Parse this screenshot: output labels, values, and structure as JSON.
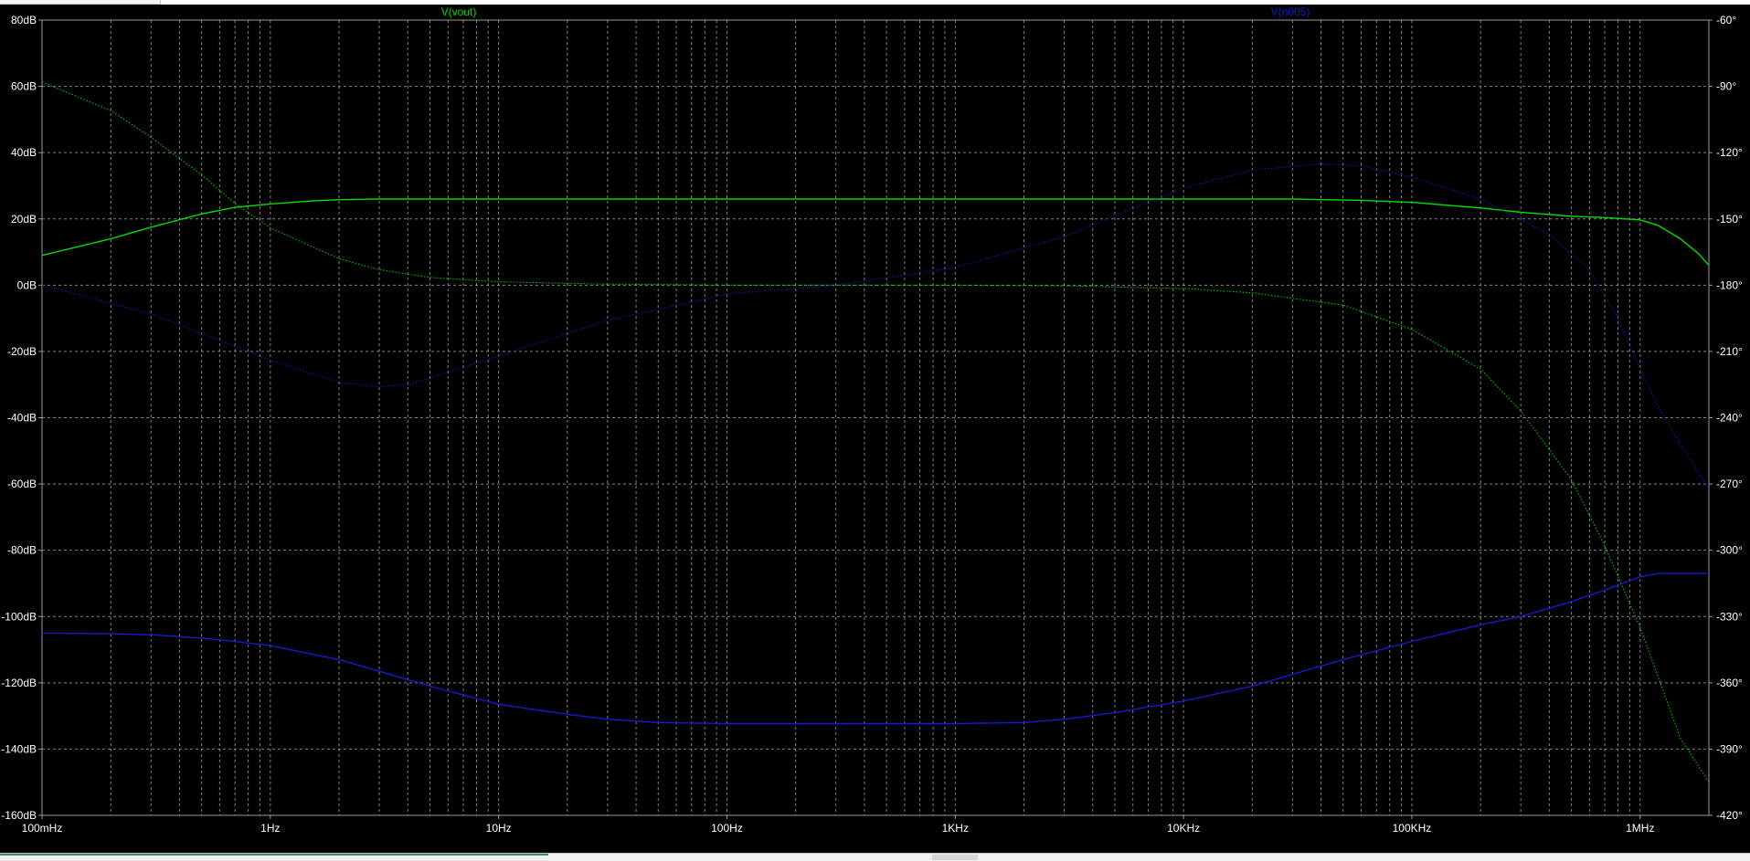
{
  "window": {
    "top_bar": "",
    "bottom_bar": ""
  },
  "colors": {
    "background": "#000000",
    "grid": "#9a9a9a",
    "axis_frame": "#9a9a9a",
    "tick_text": "#ffffff",
    "vout": "#00dd00",
    "vn005": "#1a1acc"
  },
  "chart_data": {
    "type": "line",
    "title": "",
    "x_scale": "log",
    "xlim": [
      0.1,
      2000000
    ],
    "x_ticks": [
      {
        "value": 0.1,
        "label": "100mHz"
      },
      {
        "value": 1,
        "label": "1Hz"
      },
      {
        "value": 10,
        "label": "10Hz"
      },
      {
        "value": 100,
        "label": "100Hz"
      },
      {
        "value": 1000,
        "label": "1KHz"
      },
      {
        "value": 10000,
        "label": "10KHz"
      },
      {
        "value": 100000,
        "label": "100KHz"
      },
      {
        "value": 1000000,
        "label": "1MHz"
      }
    ],
    "y_left": {
      "unit": "dB",
      "ylim": [
        -160,
        80
      ],
      "ticks": [
        "80dB",
        "60dB",
        "40dB",
        "20dB",
        "0dB",
        "-20dB",
        "-40dB",
        "-60dB",
        "-80dB",
        "-100dB",
        "-120dB",
        "-140dB",
        "-160dB"
      ]
    },
    "y_right": {
      "unit": "°",
      "ylim": [
        -420,
        -60
      ],
      "ticks": [
        "-60°",
        "-90°",
        "-120°",
        "-150°",
        "-180°",
        "-210°",
        "-240°",
        "-270°",
        "-300°",
        "-330°",
        "-360°",
        "-390°",
        "-420°"
      ]
    },
    "grid": true,
    "legend_position": "top",
    "series": [
      {
        "name": "V(vout)",
        "color": "#00dd00",
        "magnitude_db": [
          [
            0.1,
            9
          ],
          [
            0.2,
            14
          ],
          [
            0.3,
            17.5
          ],
          [
            0.5,
            21.5
          ],
          [
            0.7,
            23.5
          ],
          [
            1,
            24.5
          ],
          [
            1.5,
            25.4
          ],
          [
            2,
            25.8
          ],
          [
            3,
            26
          ],
          [
            10,
            26
          ],
          [
            1000,
            26
          ],
          [
            10000,
            26
          ],
          [
            30000,
            26
          ],
          [
            60000,
            25.6
          ],
          [
            100000,
            25
          ],
          [
            200000,
            23.3
          ],
          [
            300000,
            22
          ],
          [
            500000,
            20.8
          ],
          [
            700000,
            20.4
          ],
          [
            1000000,
            19.7
          ],
          [
            1200000,
            18
          ],
          [
            1500000,
            14
          ],
          [
            1800000,
            9.5
          ],
          [
            2000000,
            6
          ]
        ],
        "phase_deg": [
          [
            0.1,
            -88
          ],
          [
            0.2,
            -101
          ],
          [
            0.3,
            -113
          ],
          [
            0.5,
            -130
          ],
          [
            0.7,
            -143
          ],
          [
            1,
            -154
          ],
          [
            2,
            -168
          ],
          [
            3,
            -173
          ],
          [
            5,
            -176.5
          ],
          [
            10,
            -178.5
          ],
          [
            30,
            -179.5
          ],
          [
            100,
            -180
          ],
          [
            1000,
            -180
          ],
          [
            3000,
            -180.3
          ],
          [
            10000,
            -181.5
          ],
          [
            20000,
            -183.5
          ],
          [
            50000,
            -189
          ],
          [
            100000,
            -200
          ],
          [
            200000,
            -218
          ],
          [
            300000,
            -237
          ],
          [
            500000,
            -268
          ],
          [
            700000,
            -298
          ],
          [
            1000000,
            -335
          ],
          [
            1500000,
            -385
          ],
          [
            2000000,
            -405
          ]
        ]
      },
      {
        "name": "V(n005)",
        "color": "#1a1acc",
        "magnitude_db": [
          [
            0.1,
            -105
          ],
          [
            0.2,
            -105.2
          ],
          [
            0.3,
            -105.5
          ],
          [
            0.5,
            -106.5
          ],
          [
            0.7,
            -107.5
          ],
          [
            1,
            -108.8
          ],
          [
            2,
            -113
          ],
          [
            3,
            -116.5
          ],
          [
            5,
            -121
          ],
          [
            10,
            -126.5
          ],
          [
            20,
            -129.5
          ],
          [
            30,
            -131
          ],
          [
            50,
            -132
          ],
          [
            100,
            -132.3
          ],
          [
            1000,
            -132.3
          ],
          [
            2000,
            -132
          ],
          [
            3000,
            -131
          ],
          [
            5000,
            -129
          ],
          [
            10000,
            -125.5
          ],
          [
            20000,
            -121
          ],
          [
            50000,
            -113
          ],
          [
            100000,
            -107.5
          ],
          [
            200000,
            -102.5
          ],
          [
            300000,
            -100
          ],
          [
            500000,
            -95.5
          ],
          [
            700000,
            -92
          ],
          [
            1000000,
            -88
          ],
          [
            1200000,
            -87
          ],
          [
            2000000,
            -87
          ]
        ],
        "phase_deg": [
          [
            0.1,
            -180
          ],
          [
            0.3,
            -193
          ],
          [
            1,
            -214
          ],
          [
            2,
            -224
          ],
          [
            3,
            -226
          ],
          [
            4,
            -225
          ],
          [
            5,
            -222
          ],
          [
            10,
            -212
          ],
          [
            30,
            -196
          ],
          [
            100,
            -184
          ],
          [
            300,
            -180
          ],
          [
            1000,
            -172
          ],
          [
            3000,
            -158
          ],
          [
            10000,
            -136
          ],
          [
            20000,
            -128
          ],
          [
            40000,
            -125
          ],
          [
            60000,
            -126
          ],
          [
            100000,
            -131
          ],
          [
            200000,
            -141
          ],
          [
            400000,
            -157
          ],
          [
            600000,
            -173
          ],
          [
            800000,
            -195
          ],
          [
            1000000,
            -218
          ],
          [
            1200000,
            -235
          ],
          [
            1500000,
            -252
          ],
          [
            2000000,
            -272
          ]
        ]
      }
    ]
  }
}
